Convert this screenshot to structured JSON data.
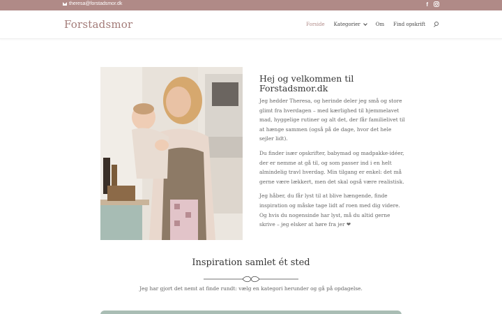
{
  "topbar": {
    "email": "theresa@forstadsmor.dk",
    "social": [
      "facebook-icon",
      "instagram-icon"
    ],
    "color": "#b08a87"
  },
  "header": {
    "logo": "Forstadsmor",
    "nav": [
      {
        "label": "Forside",
        "active": true
      },
      {
        "label": "Kategorier",
        "dropdown": true
      },
      {
        "label": "Om"
      },
      {
        "label": "Find opskrift"
      }
    ]
  },
  "intro": {
    "title": "Hej og velkommen til Forstadsmor.dk",
    "paragraphs": [
      "Jeg hedder Theresa, og herinde deler jeg små og store glimt fra hverdagen – med kærlighed til hjemmelavet mad, hyggelige rutiner og alt det, der får familielivet til at hænge sammen (også på de dage, hvor det hele sejler lidt).",
      "Du finder især opskrifter, babymad og madpakke-idéer, der er nemme at gå til, og som passer ind i en helt almindelig travl hverdag. Min tilgang er enkel: det må gerne være lækkert, men det skal også være realistisk.",
      "Jeg håber, du får lyst til at blive hængende, finde inspiration og måske tage lidt af roen med dig videre. Og hvis du nogensinde har lyst, må du altid gerne skrive – jeg elsker at høre fra jer ❤"
    ]
  },
  "section": {
    "title": "Inspiration samlet ét sted",
    "subtitle": "Jeg har gjort det nemt at finde rundt: vælg en kategori herunder og gå på opdagelse."
  },
  "colors": {
    "accent": "#b08a87",
    "card": "#a9bdb4"
  }
}
